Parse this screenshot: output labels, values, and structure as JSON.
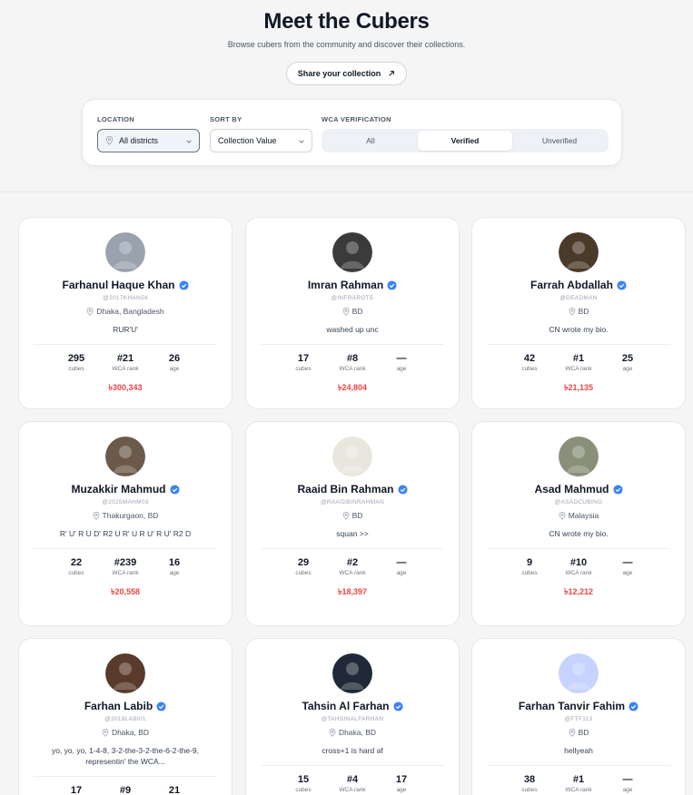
{
  "header": {
    "title": "Meet the Cubers",
    "subtitle": "Browse cubers from the community and discover their collections.",
    "share_label": "Share your collection"
  },
  "filters": {
    "location_label": "LOCATION",
    "location_value": "All districts",
    "sort_label": "SORT BY",
    "sort_value": "Collection Value",
    "wca_label": "WCA VERIFICATION",
    "wca_options": [
      "All",
      "Verified",
      "Unverified"
    ],
    "wca_selected": "Verified"
  },
  "stat_labels": {
    "cubes": "cubes",
    "rank": "WCA rank",
    "age": "age"
  },
  "cubers": [
    {
      "name": "Farhanul Haque Khan",
      "handle": "@2017KHAN54",
      "location": "Dhaka, Bangladesh",
      "bio": "RUR'U'",
      "cubes": "295",
      "rank": "#21",
      "age": "26",
      "value": "৳300,343",
      "avatar_color": "#9aa3ad"
    },
    {
      "name": "Imran Rahman",
      "handle": "@INFRAROTE",
      "location": "BD",
      "bio": "washed up unc",
      "cubes": "17",
      "rank": "#8",
      "age": "—",
      "value": "৳24,804",
      "avatar_color": "#3b3b3b"
    },
    {
      "name": "Farrah Abdallah",
      "handle": "@DEADMAN",
      "location": "BD",
      "bio": "CN wrote my bio.",
      "cubes": "42",
      "rank": "#1",
      "age": "25",
      "value": "৳21,135",
      "avatar_color": "#4a3a2a"
    },
    {
      "name": "Muzakkir Mahmud",
      "handle": "@2025MAHM03",
      "location": "Thakurgaon, BD",
      "bio": "R' U' R U D' R2 U R' U R U' R U' R2 D",
      "cubes": "22",
      "rank": "#239",
      "age": "16",
      "value": "৳20,558",
      "avatar_color": "#6b5a4a"
    },
    {
      "name": "Raaid Bin Rahman",
      "handle": "@RAAIDBINRAHMAN",
      "location": "BD",
      "bio": "squan >>",
      "cubes": "29",
      "rank": "#2",
      "age": "—",
      "value": "৳18,397",
      "avatar_color": "#e9e6de"
    },
    {
      "name": "Asad Mahmud",
      "handle": "@ASADCUBING",
      "location": "Malaysia",
      "bio": "CN wrote my bio.",
      "cubes": "9",
      "rank": "#10",
      "age": "—",
      "value": "৳12,212",
      "avatar_color": "#8a8f7a"
    },
    {
      "name": "Farhan Labib",
      "handle": "@2019LABI01",
      "location": "Dhaka, BD",
      "bio": "yo, yo, yo, 1-4-8, 3-2-the-3-2-the-6-2-the-9, representin' the WCA...",
      "cubes": "17",
      "rank": "#9",
      "age": "21",
      "value": "",
      "avatar_color": "#5a3a2a"
    },
    {
      "name": "Tahsin Al Farhan",
      "handle": "@TAHSINALFARHAN",
      "location": "Dhaka, BD",
      "bio": "cross+1 is hard af",
      "cubes": "15",
      "rank": "#4",
      "age": "17",
      "value": "",
      "avatar_color": "#1f2937"
    },
    {
      "name": "Farhan Tanvir Fahim",
      "handle": "@FTF113",
      "location": "BD",
      "bio": "hellyeah",
      "cubes": "38",
      "rank": "#1",
      "age": "—",
      "value": "",
      "avatar_color": "#c7d2fe"
    }
  ],
  "colors": {
    "accent_value": "#ef4444",
    "verified": "#3b82f6"
  }
}
